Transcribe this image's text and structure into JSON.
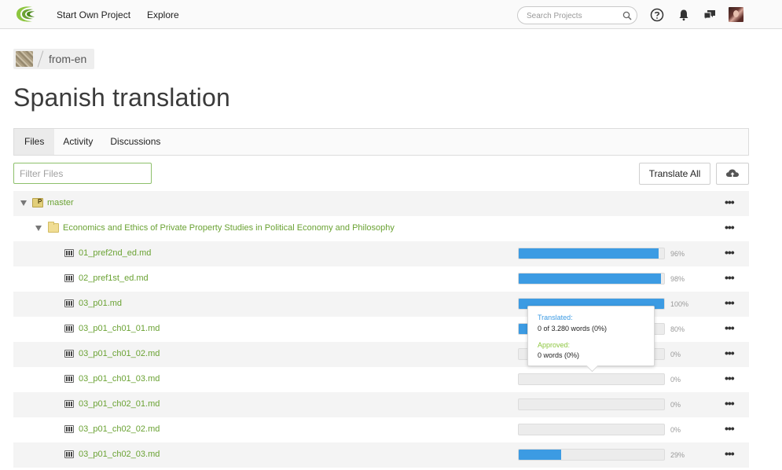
{
  "nav": {
    "start_own_project": "Start Own Project",
    "explore": "Explore",
    "search_placeholder": "Search Projects"
  },
  "breadcrumb": {
    "name": "from-en"
  },
  "page": {
    "title": "Spanish translation"
  },
  "tabs": [
    "Files",
    "Activity",
    "Discussions"
  ],
  "filter": {
    "placeholder": "Filter Files"
  },
  "buttons": {
    "translate_all": "Translate All"
  },
  "colors": {
    "accent_green": "#6aa233",
    "progress_blue": "#3c9be3",
    "approved_green": "#8dc63f",
    "translated_blue": "#3c9be3"
  },
  "tree": {
    "branch": "master",
    "folder": "Economics and Ethics of Private Property Studies in Political Economy and Philosophy",
    "more_label": "•••"
  },
  "files": [
    {
      "name": "01_pref2nd_ed.md",
      "progress": 0.96,
      "pct": "96%"
    },
    {
      "name": "02_pref1st_ed.md",
      "progress": 0.98,
      "pct": "98%"
    },
    {
      "name": "03_p01.md",
      "progress": 1.0,
      "pct": "100%"
    },
    {
      "name": "03_p01_ch01_01.md",
      "progress": 0.8,
      "pct": "80%"
    },
    {
      "name": "03_p01_ch01_02.md",
      "progress": 0.0,
      "pct": "0%"
    },
    {
      "name": "03_p01_ch01_03.md",
      "progress": 0.0,
      "pct": "0%"
    },
    {
      "name": "03_p01_ch02_01.md",
      "progress": 0.0,
      "pct": "0%"
    },
    {
      "name": "03_p01_ch02_02.md",
      "progress": 0.0,
      "pct": "0%"
    },
    {
      "name": "03_p01_ch02_03.md",
      "progress": 0.29,
      "pct": "29%"
    }
  ],
  "tooltip": {
    "translated_label": "Translated:",
    "translated_value": "0 of 3.280 words (0%)",
    "approved_label": "Approved:",
    "approved_value": "0 words (0%)"
  }
}
